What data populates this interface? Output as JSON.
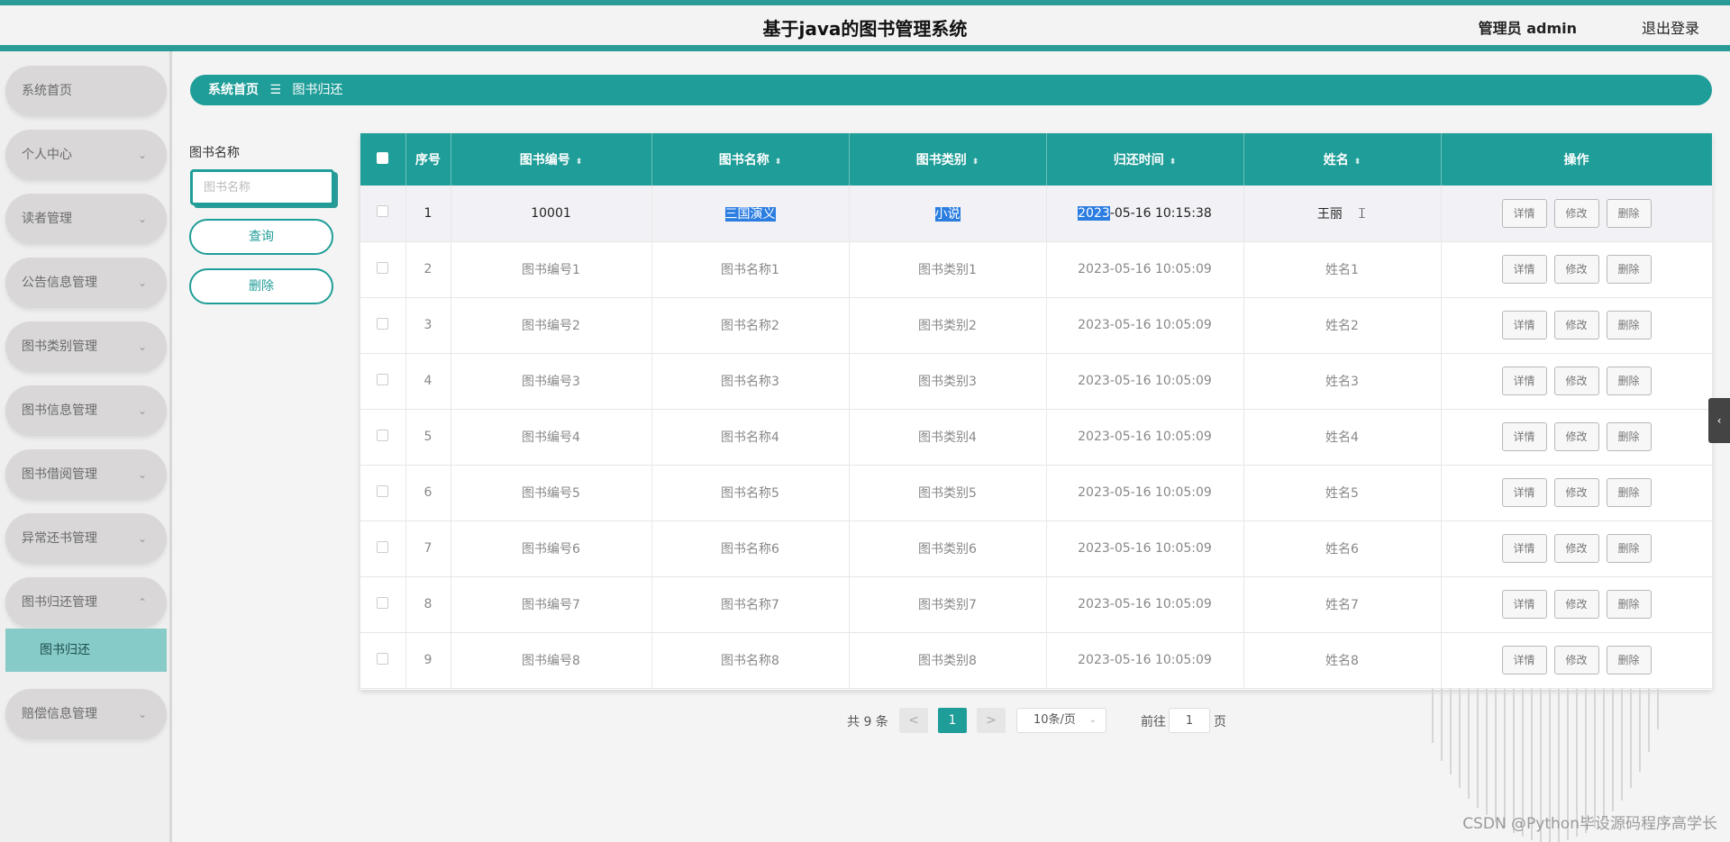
{
  "header": {
    "title": "基于java的图书管理系统",
    "admin_label": "管理员 admin",
    "logout_label": "退出登录"
  },
  "sidebar": {
    "items": [
      {
        "label": "系统首页",
        "chevron": ""
      },
      {
        "label": "个人中心",
        "chevron": "⌄"
      },
      {
        "label": "读者管理",
        "chevron": "⌄"
      },
      {
        "label": "公告信息管理",
        "chevron": "⌄"
      },
      {
        "label": "图书类别管理",
        "chevron": "⌄"
      },
      {
        "label": "图书信息管理",
        "chevron": "⌄"
      },
      {
        "label": "图书借阅管理",
        "chevron": "⌄"
      },
      {
        "label": "异常还书管理",
        "chevron": "⌄"
      },
      {
        "label": "图书归还管理",
        "chevron": "⌃"
      },
      {
        "label": "赔偿信息管理",
        "chevron": "⌄"
      }
    ],
    "subitem": "图书归还"
  },
  "breadcrumb": {
    "home": "系统首页",
    "sep": "☰",
    "current": "图书归还"
  },
  "filter": {
    "label": "图书名称",
    "placeholder": "图书名称",
    "query_label": "查询",
    "delete_label": "删除"
  },
  "table": {
    "headers": {
      "index": "序号",
      "book_no": "图书编号",
      "book_name": "图书名称",
      "category": "图书类别",
      "return_time": "归还时间",
      "name": "姓名",
      "ops": "操作"
    },
    "sort_icon": "⬍",
    "row_actions": {
      "detail": "详情",
      "edit": "修改",
      "delete": "删除"
    },
    "rows": [
      {
        "idx": "1",
        "book_no": "10001",
        "book_name": "三国演义",
        "category": "小说",
        "return_time_sel": "2023",
        "return_time_rest": "-05-16 10:15:38",
        "name": "王丽"
      },
      {
        "idx": "2",
        "book_no": "图书编号1",
        "book_name": "图书名称1",
        "category": "图书类别1",
        "return_time": "2023-05-16 10:05:09",
        "name": "姓名1"
      },
      {
        "idx": "3",
        "book_no": "图书编号2",
        "book_name": "图书名称2",
        "category": "图书类别2",
        "return_time": "2023-05-16 10:05:09",
        "name": "姓名2"
      },
      {
        "idx": "4",
        "book_no": "图书编号3",
        "book_name": "图书名称3",
        "category": "图书类别3",
        "return_time": "2023-05-16 10:05:09",
        "name": "姓名3"
      },
      {
        "idx": "5",
        "book_no": "图书编号4",
        "book_name": "图书名称4",
        "category": "图书类别4",
        "return_time": "2023-05-16 10:05:09",
        "name": "姓名4"
      },
      {
        "idx": "6",
        "book_no": "图书编号5",
        "book_name": "图书名称5",
        "category": "图书类别5",
        "return_time": "2023-05-16 10:05:09",
        "name": "姓名5"
      },
      {
        "idx": "7",
        "book_no": "图书编号6",
        "book_name": "图书名称6",
        "category": "图书类别6",
        "return_time": "2023-05-16 10:05:09",
        "name": "姓名6"
      },
      {
        "idx": "8",
        "book_no": "图书编号7",
        "book_name": "图书名称7",
        "category": "图书类别7",
        "return_time": "2023-05-16 10:05:09",
        "name": "姓名7"
      },
      {
        "idx": "9",
        "book_no": "图书编号8",
        "book_name": "图书名称8",
        "category": "图书类别8",
        "return_time": "2023-05-16 10:05:09",
        "name": "姓名8"
      }
    ]
  },
  "pagination": {
    "total": "共 9 条",
    "prev": "<",
    "current": "1",
    "next": ">",
    "page_size": "10条/页",
    "goto_prefix": "前往",
    "goto_value": "1",
    "goto_suffix": "页"
  },
  "side_tab_icon": "‹",
  "watermark": "CSDN @Python毕设源码程序高学长",
  "colors": {
    "accent": "#1f9d98",
    "submenu": "#87cbc8",
    "selection": "#2b7de0"
  }
}
